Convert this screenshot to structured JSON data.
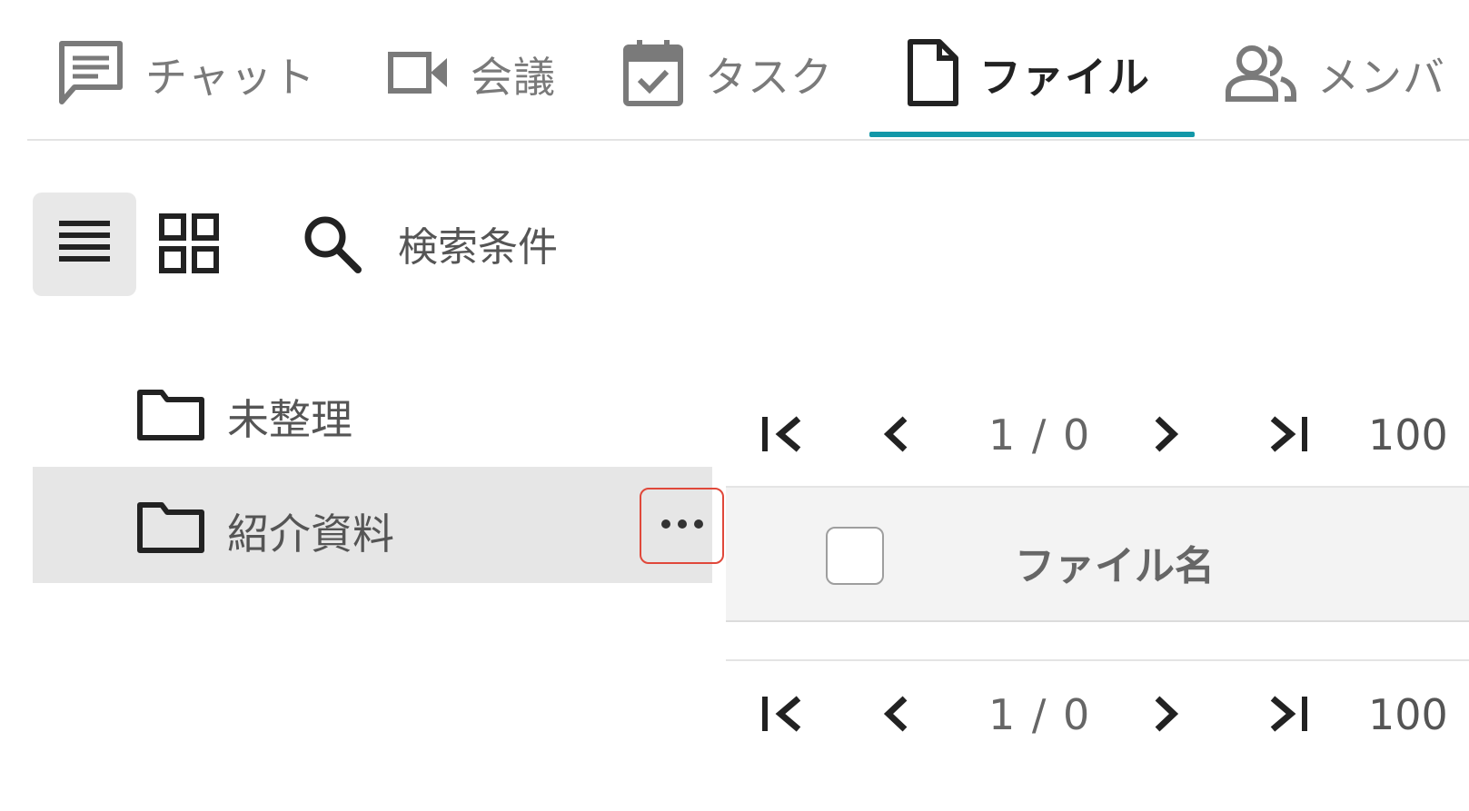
{
  "tabs": [
    {
      "label": "チャット",
      "icon": "chat-icon"
    },
    {
      "label": "会議",
      "icon": "video-icon"
    },
    {
      "label": "タスク",
      "icon": "calendar-check-icon"
    },
    {
      "label": "ファイル",
      "icon": "file-icon",
      "active": true
    },
    {
      "label": "メンバ",
      "icon": "members-icon"
    }
  ],
  "toolbar": {
    "list_view_icon": "list-view-icon",
    "grid_view_icon": "grid-view-icon",
    "search_icon": "search-icon",
    "search_label": "検索条件"
  },
  "folders": [
    {
      "label": "未整理",
      "icon": "folder-icon"
    },
    {
      "label": "紹介資料",
      "icon": "folder-icon",
      "selected": true,
      "more_icon": "more-horizontal-icon"
    }
  ],
  "pagination_top": {
    "page_info": "1 / 0",
    "page_size": "100"
  },
  "table": {
    "columns": [
      "ファイル名"
    ]
  },
  "pagination_bottom": {
    "page_info": "1 / 0",
    "page_size": "100"
  },
  "colors": {
    "accent": "#1297a8",
    "highlight_border": "#e0483a",
    "selected_row": "#e6e6e6"
  }
}
